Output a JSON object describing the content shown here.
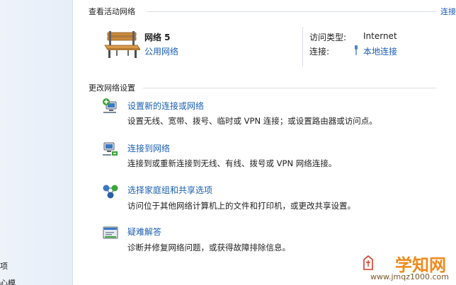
{
  "left_nav": {
    "fragment_1": "项",
    "fragment_2": "心模"
  },
  "active_networks": {
    "header": "查看活动网络",
    "header_link": "连接",
    "network_name": "网络  5",
    "network_category": "公用网络",
    "access_type_label": "访问类型:",
    "access_type_value": "Internet",
    "connections_label": "连接:",
    "connections_value": "本地连接"
  },
  "change_settings": {
    "header": "更改网络设置",
    "tasks": [
      {
        "title": "设置新的连接或网络",
        "description": "设置无线、宽带、拨号、临时或 VPN 连接；或设置路由器或访问点。",
        "icon": "network-setup-icon"
      },
      {
        "title": "连接到网络",
        "description": "连接到或重新连接到无线、有线、拨号或 VPN 网络连接。",
        "icon": "connect-network-icon"
      },
      {
        "title": "选择家庭组和共享选项",
        "description": "访问位于其他网络计算机上的文件和打印机，或更改共享设置。",
        "icon": "homegroup-icon"
      },
      {
        "title": "疑难解答",
        "description": "诊断并修复网络问题，或获得故障排除信息。",
        "icon": "troubleshoot-icon"
      }
    ]
  },
  "watermark": {
    "title": "学知网",
    "url": "www.jmqz1000.com"
  },
  "colors": {
    "link": "#1a5fb4",
    "watermark_orange": "#f08a1c"
  }
}
